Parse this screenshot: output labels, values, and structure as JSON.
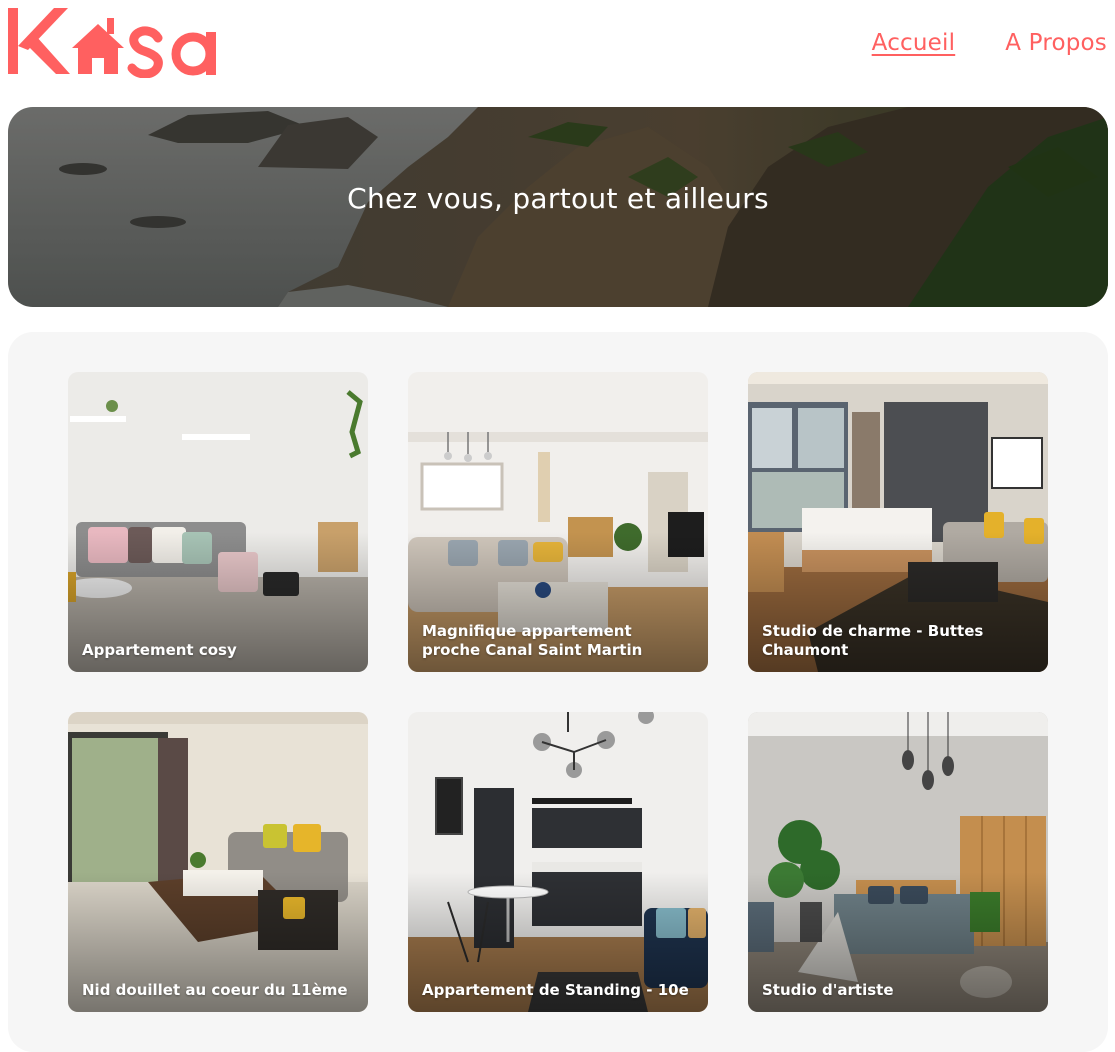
{
  "brand": {
    "logo_letters_left": "K",
    "logo_letters_right": "sa",
    "logo_icon": "house-icon",
    "color": "#FF6060"
  },
  "nav": {
    "items": [
      {
        "label": "Accueil",
        "active": true
      },
      {
        "label": "A Propos",
        "active": false
      }
    ]
  },
  "banner": {
    "title": "Chez vous, partout et ailleurs"
  },
  "listings": [
    {
      "title": "Appartement cosy"
    },
    {
      "title": "Magnifique appartement proche Canal Saint Martin"
    },
    {
      "title": "Studio de charme - Buttes Chaumont"
    },
    {
      "title": "Nid douillet au coeur du 11ème"
    },
    {
      "title": "Appartement de Standing - 10e"
    },
    {
      "title": "Studio d'artiste"
    }
  ]
}
